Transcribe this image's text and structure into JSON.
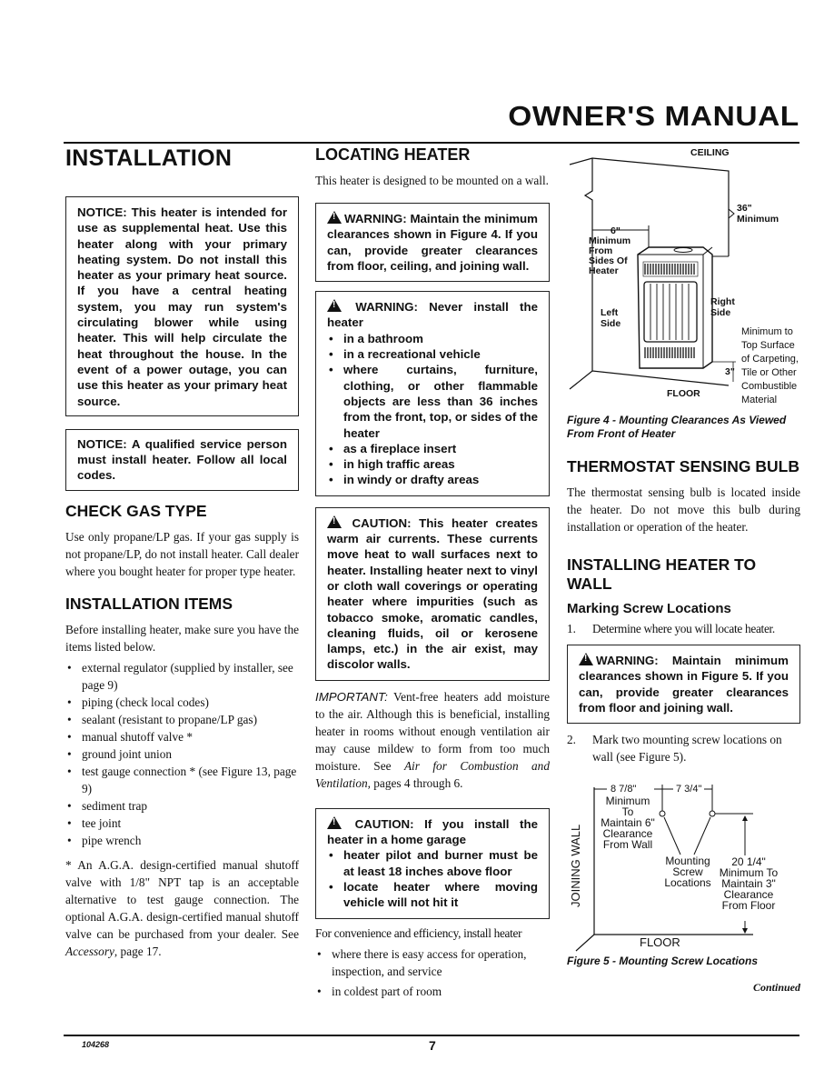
{
  "header": {
    "masthead": "OWNER'S MANUAL"
  },
  "column1": {
    "section_title": "INSTALLATION",
    "notice1": "NOTICE: This heater is intended for use as supplemental heat. Use this heater along with your primary heating system. Do not install this heater as your primary heat source. If you have a central heating system, you may run system's circulating blower while using heater. This will help circulate the heat throughout the house. In the event of a power outage, you can use this heater as your primary heat source.",
    "notice2": "NOTICE: A qualified service person must install heater. Follow all local codes.",
    "check_gas": {
      "heading": "CHECK GAS TYPE",
      "body": "Use only propane/LP gas. If your gas supply is not propane/LP, do not install heater. Call dealer where you bought heater for proper type heater."
    },
    "installation_items": {
      "heading": "INSTALLATION ITEMS",
      "intro": "Before installing heater, make sure you have the items listed below.",
      "items": [
        "external regulator (supplied by installer, see page 9)",
        "piping (check local codes)",
        "sealant (resistant to propane/LP gas)",
        "manual shutoff valve *",
        "ground joint union",
        "test gauge connection * (see Figure 13, page 9)",
        "sediment trap",
        "tee joint",
        "pipe wrench"
      ],
      "footnote_a": "* An A.G.A. design-certified manual shutoff valve with 1/8\" NPT tap is an acceptable alternative to test gauge connection. The optional A.G.A. design-certified manual shutoff valve can be purchased from your dealer. See ",
      "footnote_italic": "Accessory",
      "footnote_b": ", page 17."
    }
  },
  "column2": {
    "heading": "LOCATING HEATER",
    "intro": "This heater is designed to be mounted on a wall.",
    "warning1": "WARNING: Maintain the minimum clearances shown in Figure 4. If you can, provide greater clearances from floor, ceiling, and joining wall.",
    "warning2": {
      "title": "WARNING: Never install the heater",
      "items": [
        "in a bathroom",
        "in a recreational vehicle",
        "where curtains, furniture, clothing, or other flammable objects are less than 36 inches from the front, top, or sides of the heater",
        "as a fireplace insert",
        "in high traffic areas",
        "in windy or drafty areas"
      ]
    },
    "caution1": "CAUTION: This heater creates warm air currents. These currents move heat to wall surfaces next to heater. Installing heater next to vinyl or cloth wall coverings or operating heater where impurities (such as tobacco smoke, aromatic candles, cleaning fluids, oil or kerosene lamps, etc.) in the air exist, may discolor walls.",
    "important_label": "IMPORTANT:",
    "important_body": " Vent-free heaters add moisture to the air. Although this is beneficial, installing heater in rooms without enough ventilation air may cause mildew to form from too much moisture. See ",
    "important_ref": "Air for Combustion and Ventilation,",
    "important_tail": " pages 4 through 6.",
    "caution2": {
      "title": "CAUTION: If you install the heater in a home garage",
      "items": [
        "heater pilot and burner must be at least 18 inches above floor",
        "locate heater where moving vehicle will not hit it"
      ]
    },
    "convenience_intro": "For convenience and efficiency, install heater",
    "convenience_items": [
      "where there is easy access for operation, inspection, and service",
      "in coldest part of room"
    ]
  },
  "column3": {
    "figure4": {
      "ceiling": "CEILING",
      "top_clear_1": "36\"",
      "top_clear_2": "Minimum",
      "side_clear": [
        "6\"",
        "Minimum",
        "From",
        "Sides Of",
        "Heater"
      ],
      "left_side": [
        "Left",
        "Side"
      ],
      "right_side": [
        "Right",
        "Side"
      ],
      "floor": "FLOOR",
      "floor_clear_value": "3\"",
      "floor_note": [
        "Minimum to",
        "Top Surface",
        "of Carpeting,",
        "Tile or Other",
        "Combustible",
        "Material"
      ],
      "caption": "Figure 4 - Mounting Clearances As Viewed From Front of Heater"
    },
    "thermostat": {
      "heading": "THERMOSTAT SENSING BULB",
      "body": "The thermostat sensing bulb is located inside the heater. Do not move this bulb during installation or operation of the heater."
    },
    "installing": {
      "heading": "INSTALLING HEATER TO WALL",
      "subheading": "Marking Screw Locations",
      "step1_num": "1.",
      "step1": "Determine where you will locate heater.",
      "warning": "WARNING: Maintain minimum clearances shown in Figure 5. If you can, provide greater clearances from floor and joining wall.",
      "step2_num": "2.",
      "step2": "Mark two mounting screw locations on wall (see Figure 5)."
    },
    "figure5": {
      "dim_left": "8 7/8\"",
      "dim_mid": "7 3/4\"",
      "left_note": [
        "Minimum",
        "To",
        "Maintain 6\"",
        "Clearance",
        "From Wall"
      ],
      "center_note": [
        "Mounting",
        "Screw",
        "Locations"
      ],
      "right_note": [
        "20 1/4\"",
        "Minimum To",
        "Maintain 3\"",
        "Clearance",
        "From Floor"
      ],
      "wall_label": "JOINING WALL",
      "floor_label": "FLOOR",
      "caption": "Figure 5 - Mounting Screw Locations"
    },
    "continued": "Continued"
  },
  "footer": {
    "doc_number": "104268",
    "page_number": "7"
  }
}
